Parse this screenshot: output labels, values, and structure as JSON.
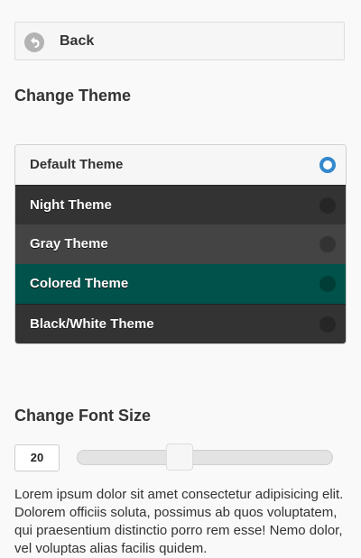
{
  "back": {
    "label": "Back",
    "icon": "back-arrow-icon"
  },
  "theme_section": {
    "heading": "Change Theme"
  },
  "themes": [
    {
      "label": "Default Theme",
      "selected": true,
      "bg": "#f6f6f6",
      "color": "#333333"
    },
    {
      "label": "Night Theme",
      "selected": false,
      "bg": "#333333",
      "color": "#ffffff"
    },
    {
      "label": "Gray Theme",
      "selected": false,
      "bg": "#444444",
      "color": "#ffffff"
    },
    {
      "label": "Colored Theme",
      "selected": false,
      "bg": "#00524a",
      "color": "#ffffff"
    },
    {
      "label": "Black/White Theme",
      "selected": false,
      "bg": "#333333",
      "color": "#ffffff"
    }
  ],
  "font_section": {
    "heading": "Change Font Size",
    "value": "20",
    "slider_fraction": 0.39
  },
  "paragraph": "Lorem ipsum dolor sit amet consectetur adipisicing elit. Dolorem officiis soluta, possimus ab quos voluptatem, qui praesentium distinctio porro rem esse! Nemo dolor, vel voluptas alias facilis quidem.",
  "colors": {
    "accent": "#3388cc",
    "page_bg": "#f9f9f9"
  }
}
